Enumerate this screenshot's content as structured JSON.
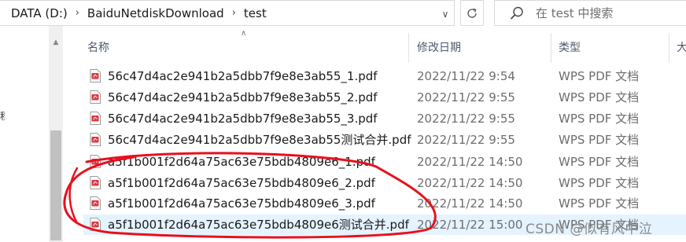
{
  "address_bar": {
    "crumbs": [
      "DATA (D:)",
      "BaiduNetdiskDownload",
      "test"
    ]
  },
  "search": {
    "placeholder": "在 test 中搜索"
  },
  "columns": {
    "name": "名称",
    "modified": "修改日期",
    "type": "类型",
    "size_fragment": "大"
  },
  "left_fragment": "程",
  "files": [
    {
      "name": "56c47d4ac2e941b2a5dbb7f9e8e3ab55_1.pdf",
      "modified": "2022/11/22 9:54",
      "type": "WPS PDF 文档"
    },
    {
      "name": "56c47d4ac2e941b2a5dbb7f9e8e3ab55_2.pdf",
      "modified": "2022/11/22 9:55",
      "type": "WPS PDF 文档"
    },
    {
      "name": "56c47d4ac2e941b2a5dbb7f9e8e3ab55_3.pdf",
      "modified": "2022/11/22 9:55",
      "type": "WPS PDF 文档"
    },
    {
      "name": "56c47d4ac2e941b2a5dbb7f9e8e3ab55测试合并.pdf",
      "modified": "2022/11/22 9:55",
      "type": "WPS PDF 文档"
    },
    {
      "name": "a5f1b001f2d64a75ac63e75bdb4809e6_1.pdf",
      "modified": "2022/11/22 14:50",
      "type": "WPS PDF 文档"
    },
    {
      "name": "a5f1b001f2d64a75ac63e75bdb4809e6_2.pdf",
      "modified": "2022/11/22 14:50",
      "type": "WPS PDF 文档"
    },
    {
      "name": "a5f1b001f2d64a75ac63e75bdb4809e6_3.pdf",
      "modified": "2022/11/22 14:50",
      "type": "WPS PDF 文档"
    },
    {
      "name": "a5f1b001f2d64a75ac63e75bdb4809e6测试合并.pdf",
      "modified": "2022/11/22 15:00",
      "type": "WPS PDF 文档"
    }
  ],
  "selected_row_index": 7,
  "watermark": "CSDN @似有风中泣",
  "colors": {
    "selection": "#e5f3ff",
    "pdf_icon": "#d9373f",
    "annotation": "#e8101e"
  },
  "icons": [
    "chevron-right-icon",
    "chevron-down-icon",
    "refresh-icon",
    "search-icon",
    "sort-up-icon",
    "pdf-file-icon"
  ]
}
